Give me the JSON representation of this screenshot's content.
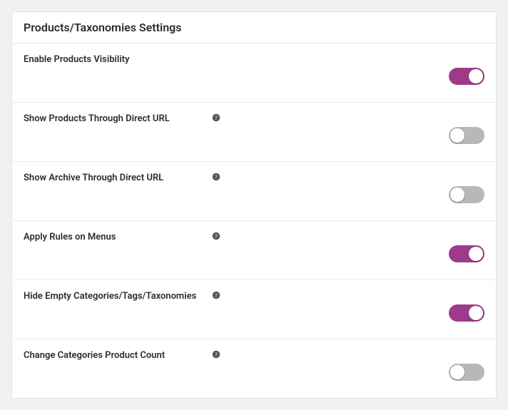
{
  "colors": {
    "toggle_on": "#9e3a8a",
    "toggle_off": "#b8b8b8"
  },
  "panel": {
    "title": "Products/Taxonomies Settings"
  },
  "settings": [
    {
      "label": "Enable Products Visibility",
      "has_help": false,
      "value": true
    },
    {
      "label": "Show Products Through Direct URL",
      "has_help": true,
      "value": false
    },
    {
      "label": "Show Archive Through Direct URL",
      "has_help": true,
      "value": false
    },
    {
      "label": "Apply Rules on Menus",
      "has_help": true,
      "value": true
    },
    {
      "label": "Hide Empty Categories/Tags/Taxonomies",
      "has_help": true,
      "value": true
    },
    {
      "label": "Change Categories Product Count",
      "has_help": true,
      "value": false
    }
  ]
}
